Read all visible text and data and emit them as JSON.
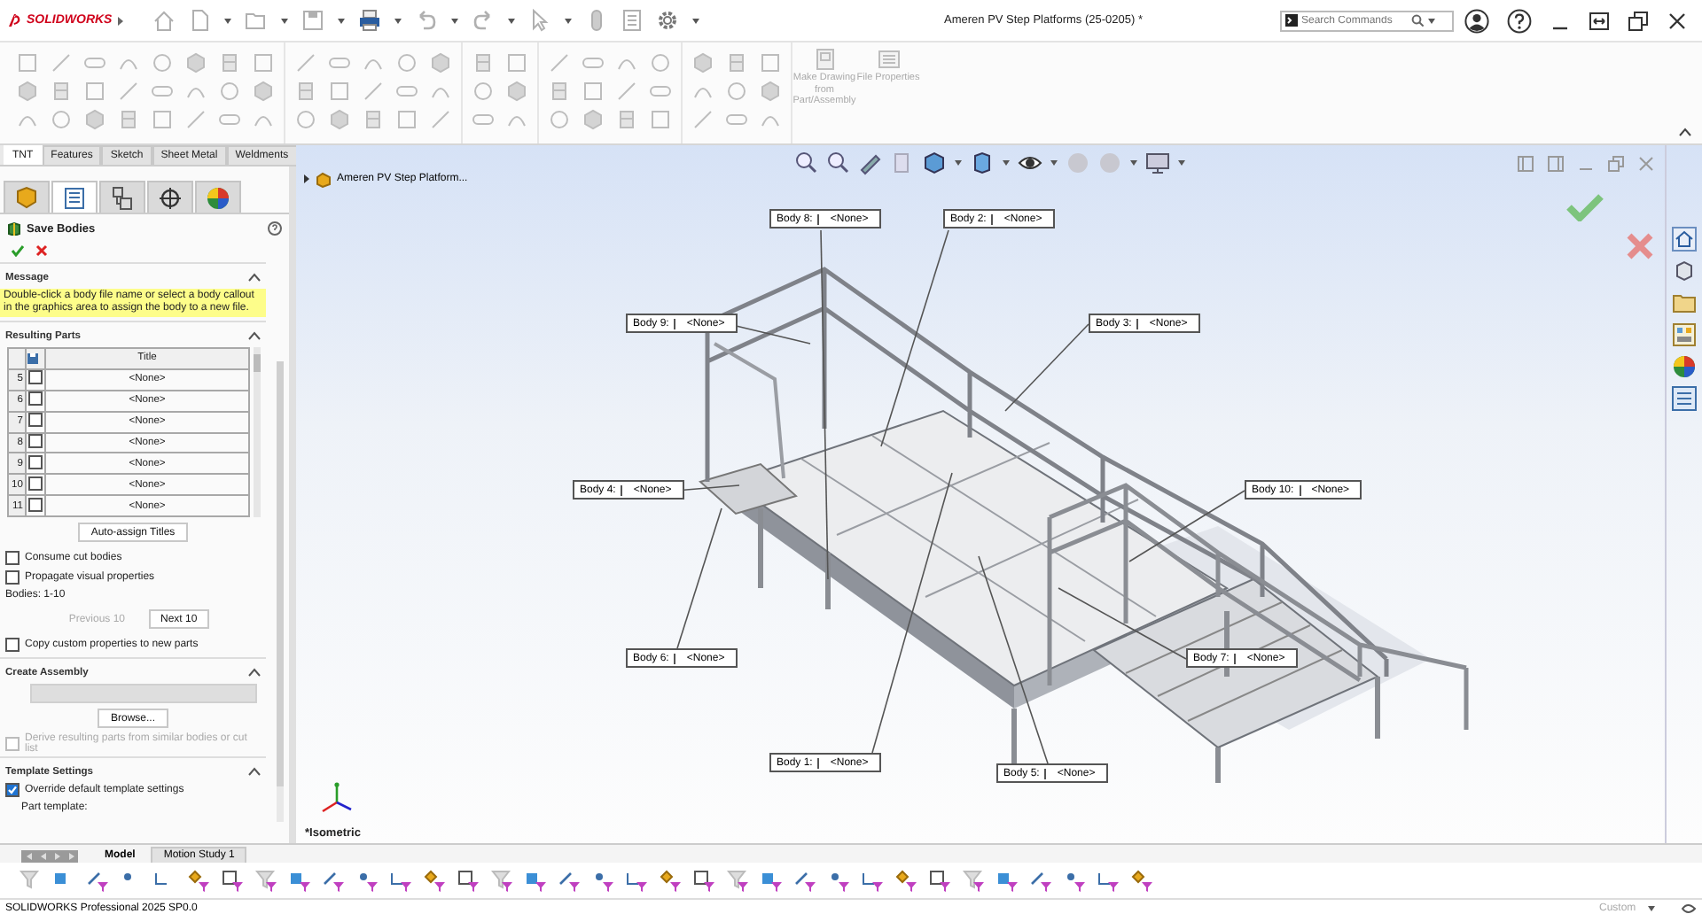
{
  "app": {
    "logo": "SOLIDWORKS",
    "title": "Ameren PV Step Platforms (25-0205) *",
    "search": {
      "placeholder": "Search Commands"
    }
  },
  "ribbon": {
    "commands": [
      {
        "label": "Make Drawing from Part/Assembly"
      },
      {
        "label": "File Properties"
      }
    ]
  },
  "command_tabs": [
    {
      "label": "TNT",
      "selected": true
    },
    {
      "label": "Features",
      "selected": false
    },
    {
      "label": "Sketch",
      "selected": false
    },
    {
      "label": "Sheet Metal",
      "selected": false
    },
    {
      "label": "Weldments",
      "selected": false
    }
  ],
  "property_manager": {
    "tabs": [
      {
        "kind": "feature",
        "selected": false
      },
      {
        "kind": "property",
        "selected": true
      },
      {
        "kind": "config",
        "selected": false
      },
      {
        "kind": "dimxpert",
        "selected": false
      },
      {
        "kind": "display",
        "selected": false
      }
    ],
    "title": "Save Bodies",
    "message": {
      "header": "Message",
      "expanded": true,
      "text": "Double-click a body file name or select a body callout in the graphics area to assign the body to a new file."
    },
    "resulting_parts": {
      "header": "Resulting Parts",
      "expanded": true,
      "column": "Title",
      "rows": [
        {
          "number": "5",
          "checked": false,
          "title": "<None>"
        },
        {
          "number": "6",
          "checked": false,
          "title": "<None>"
        },
        {
          "number": "7",
          "checked": false,
          "title": "<None>"
        },
        {
          "number": "8",
          "checked": false,
          "title": "<None>"
        },
        {
          "number": "9",
          "checked": false,
          "title": "<None>"
        },
        {
          "number": "10",
          "checked": false,
          "title": "<None>"
        },
        {
          "number": "11",
          "checked": false,
          "title": "<None>"
        }
      ],
      "auto_assign": "Auto-assign Titles",
      "options": [
        {
          "label": "Consume cut bodies",
          "checked": false
        },
        {
          "label": "Propagate visual properties",
          "checked": false
        }
      ],
      "range": "Bodies: 1-10",
      "previous": {
        "label": "Previous 10",
        "disabled": true
      },
      "next": {
        "label": "Next 10",
        "disabled": false
      },
      "copy_option": {
        "label": "Copy custom properties to new parts",
        "checked": false
      }
    },
    "create_assembly": {
      "header": "Create Assembly",
      "expanded": true,
      "browse": "Browse...",
      "derive": {
        "label": "Derive resulting parts from similar bodies or cut list",
        "checked": false,
        "disabled": true
      }
    },
    "template_settings": {
      "header": "Template Settings",
      "expanded": true,
      "override": {
        "label": "Override default template settings",
        "checked": true
      },
      "part_template_label": "Part template:"
    }
  },
  "viewport": {
    "tree_root": "Ameren PV Step Platform...",
    "view_name": "*Isometric",
    "callouts": [
      {
        "label": "Body 8:",
        "value": "<None>"
      },
      {
        "label": "Body 2:",
        "value": "<None>"
      },
      {
        "label": "Body 9:",
        "value": "<None>"
      },
      {
        "label": "Body 3:",
        "value": "<None>"
      },
      {
        "label": "Body 4:",
        "value": "<None>"
      },
      {
        "label": "Body 10:",
        "value": "<None>"
      },
      {
        "label": "Body 6:",
        "value": "<None>"
      },
      {
        "label": "Body 7:",
        "value": "<None>"
      },
      {
        "label": "Body 1:",
        "value": "<None>"
      },
      {
        "label": "Body 5:",
        "value": "<None>"
      }
    ]
  },
  "bottom_tabs": [
    {
      "label": "Model",
      "selected": true
    },
    {
      "label": "Motion Study 1",
      "selected": false
    }
  ],
  "status_bar": {
    "text": "SOLIDWORKS Professional 2025 SP0.0",
    "units": "Custom"
  }
}
